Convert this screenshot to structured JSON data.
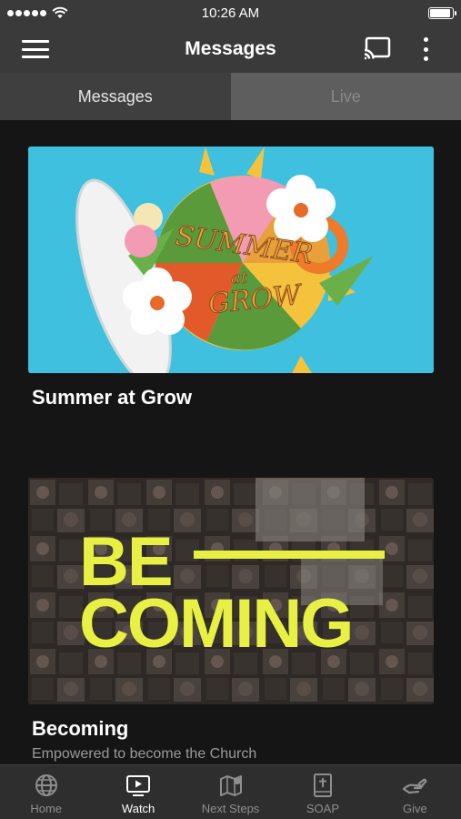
{
  "status_bar": {
    "time": "10:26 AM",
    "signal_icon": "signal-dots-icon",
    "wifi_icon": "wifi-icon",
    "battery_icon": "battery-icon",
    "battery_level": 0.95
  },
  "nav": {
    "title": "Messages",
    "menu_icon": "hamburger-menu-icon",
    "cast_icon": "cast-icon",
    "more_icon": "more-vertical-icon"
  },
  "tabs": [
    {
      "label": "Messages",
      "active": true
    },
    {
      "label": "Live",
      "active": false
    }
  ],
  "series": [
    {
      "title": "Summer at Grow",
      "subtitle": "",
      "artwork_text": "SUMMER at GROW",
      "accent": "#3ec0de"
    },
    {
      "title": "Becoming",
      "subtitle": "Empowered to become the Church",
      "artwork_text_top": "BE",
      "artwork_text_bottom": "COMING",
      "accent": "#e8f043"
    }
  ],
  "tab_bar": [
    {
      "label": "Home",
      "icon": "globe-icon",
      "active": false
    },
    {
      "label": "Watch",
      "icon": "tv-play-icon",
      "active": true
    },
    {
      "label": "Next Steps",
      "icon": "map-pin-icon",
      "active": false
    },
    {
      "label": "SOAP",
      "icon": "bible-icon",
      "active": false
    },
    {
      "label": "Give",
      "icon": "giving-hand-icon",
      "active": false
    }
  ],
  "colors": {
    "bar_bg": "#3a3a3a",
    "content_bg": "#151515",
    "active_tab_bg": "#3f3f3f",
    "inactive_tab_bg": "#5e5e5e"
  }
}
